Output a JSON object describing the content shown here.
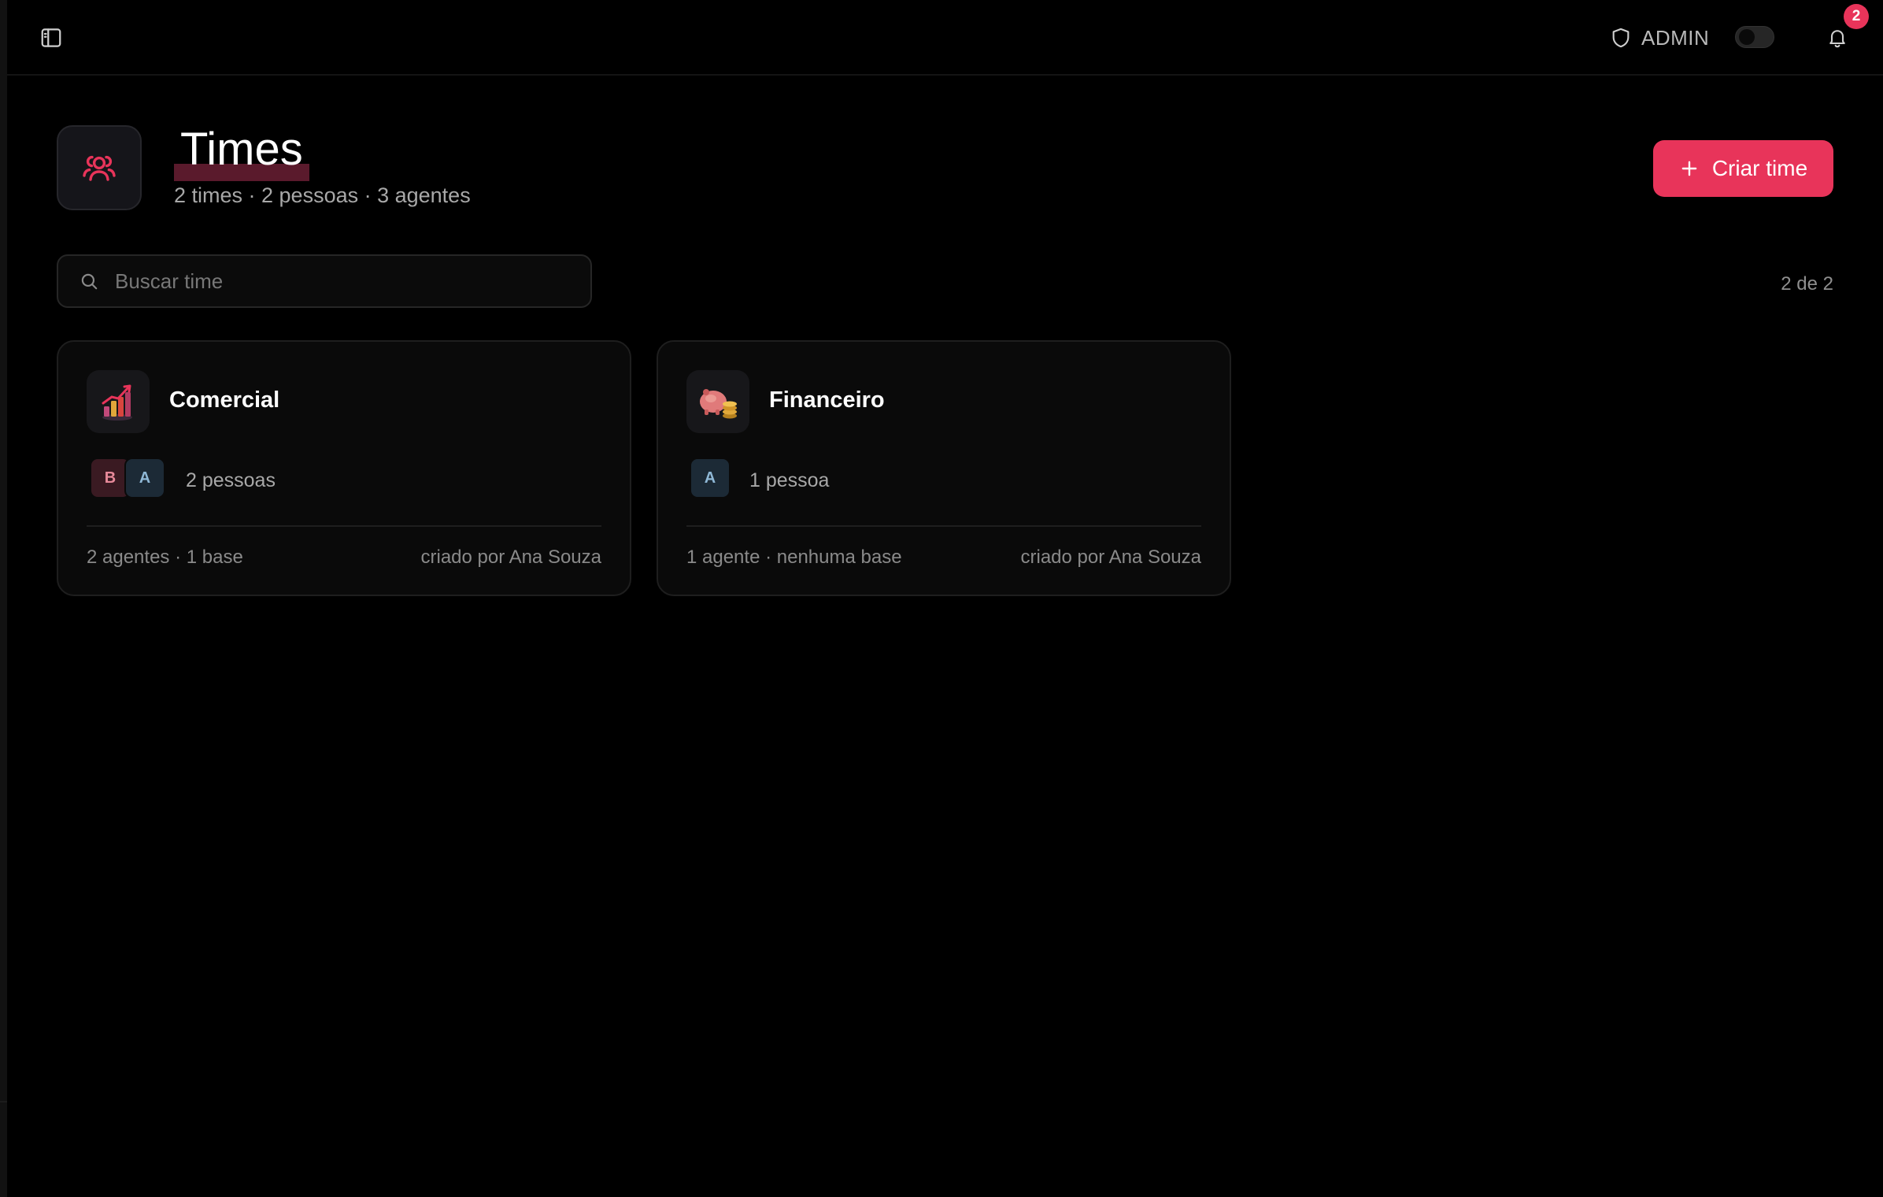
{
  "topbar": {
    "role_label": "ADMIN",
    "notification_count": "2",
    "icons": {
      "toggle_sidebar": "sidebar-panel-icon",
      "role": "shield-icon",
      "notifications": "bell-icon"
    }
  },
  "header": {
    "title": "Times",
    "subtitle": "2 times · 2 pessoas · 3 agentes",
    "icon": "users-icon",
    "create_label": "Criar time"
  },
  "search": {
    "placeholder": "Buscar time",
    "value": "",
    "count": "2 de 2"
  },
  "teams": [
    {
      "name": "Comercial",
      "icon": "bar-chart-growth-icon",
      "members": [
        "B",
        "A"
      ],
      "people": "2 pessoas",
      "meta": "2 agentes · 1 base",
      "author": "criado por Ana Souza"
    },
    {
      "name": "Financeiro",
      "icon": "piggy-bank-coins-icon",
      "members": [
        "A"
      ],
      "people": "1 pessoa",
      "meta": "1 agente · nenhuma base",
      "author": "criado por Ana Souza"
    }
  ],
  "colors": {
    "accent": "#e8345a",
    "background": "#000000",
    "card": "#0a0a0a"
  }
}
